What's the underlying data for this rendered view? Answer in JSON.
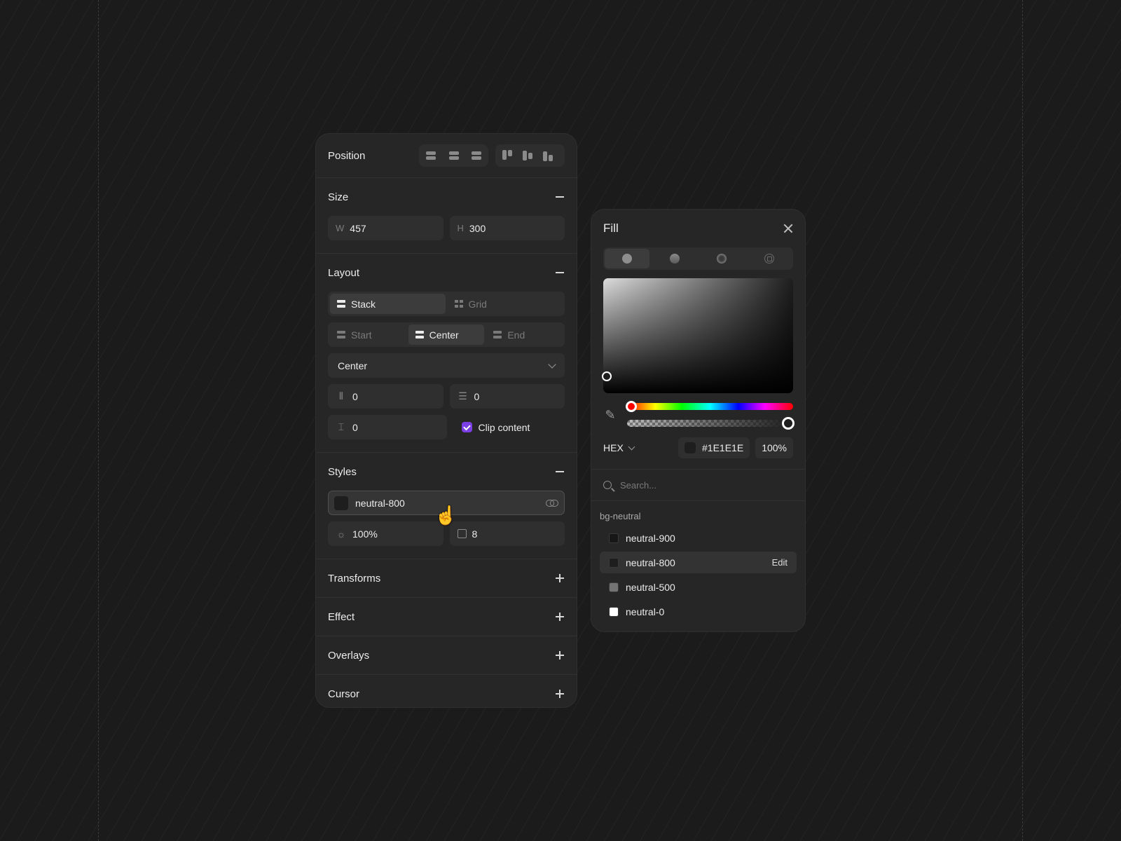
{
  "properties": {
    "position": {
      "title": "Position"
    },
    "size": {
      "title": "Size",
      "w_label": "W",
      "w_value": "457",
      "h_label": "H",
      "h_value": "300"
    },
    "layout": {
      "title": "Layout",
      "type_options": [
        "Stack",
        "Grid"
      ],
      "align_options": [
        "Start",
        "Center",
        "End"
      ],
      "distribution": "Center",
      "gap_x": "0",
      "gap_y": "0",
      "padding": "0",
      "clip_label": "Clip content"
    },
    "styles": {
      "title": "Styles",
      "fill_token": "neutral-800",
      "opacity": "100%",
      "radius": "8"
    },
    "collapsed": [
      "Transforms",
      "Effect",
      "Overlays",
      "Cursor"
    ]
  },
  "fill_panel": {
    "title": "Fill",
    "mode": "HEX",
    "hex": "#1E1E1E",
    "opacity": "100%",
    "search_placeholder": "Search...",
    "group": "bg-neutral",
    "swatches": [
      {
        "name": "neutral-900",
        "color": "#171717"
      },
      {
        "name": "neutral-800",
        "color": "#1e1e1e",
        "action": "Edit"
      },
      {
        "name": "neutral-500",
        "color": "#737373"
      },
      {
        "name": "neutral-0",
        "color": "#ffffff"
      }
    ]
  },
  "icons": [
    "align-left-icon",
    "align-center-icon",
    "align-right-icon",
    "align-top-icon",
    "align-middle-icon",
    "align-bottom-icon",
    "minus-icon",
    "plus-icon",
    "stack-icon",
    "grid-icon",
    "chevron-down-icon",
    "gap-icon",
    "padding-icon",
    "checkbox-icon",
    "link-icon",
    "brightness-icon",
    "corner-radius-icon",
    "close-icon",
    "eyedropper-icon",
    "search-icon"
  ],
  "accent": "#7b3fe4"
}
